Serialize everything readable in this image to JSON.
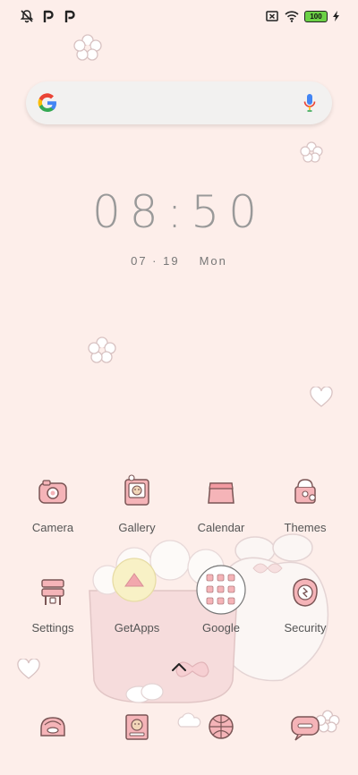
{
  "status_bar": {
    "left_icons": [
      "notification-off-icon",
      "p-icon",
      "p-icon"
    ],
    "right_icons": [
      "no-sim-icon",
      "wifi-icon",
      "battery-icon",
      "charging-icon"
    ],
    "battery_level": "100",
    "battery_color": "#6bd146"
  },
  "search": {
    "logo": "google-g-icon",
    "mic": "mic-icon"
  },
  "clock": {
    "time": "08:50",
    "date": "07 · 19",
    "weekday": "Mon"
  },
  "apps_row1": [
    {
      "label": "Camera",
      "icon": "camera-icon"
    },
    {
      "label": "Gallery",
      "icon": "gallery-icon"
    },
    {
      "label": "Calendar",
      "icon": "calendar-icon"
    },
    {
      "label": "Themes",
      "icon": "themes-icon"
    }
  ],
  "apps_row2": [
    {
      "label": "Settings",
      "icon": "settings-icon"
    },
    {
      "label": "GetApps",
      "icon": "getapps-icon"
    },
    {
      "label": "Google",
      "icon": "google-folder-icon"
    },
    {
      "label": "Security",
      "icon": "security-icon"
    }
  ],
  "dock": [
    {
      "icon": "phone-icon"
    },
    {
      "icon": "messages-icon"
    },
    {
      "icon": "browser-icon"
    },
    {
      "icon": "chat-icon"
    }
  ],
  "colors": {
    "background": "#fdeeea",
    "icon_pink": "#f2a7ad",
    "outline": "#6b4c4c"
  }
}
